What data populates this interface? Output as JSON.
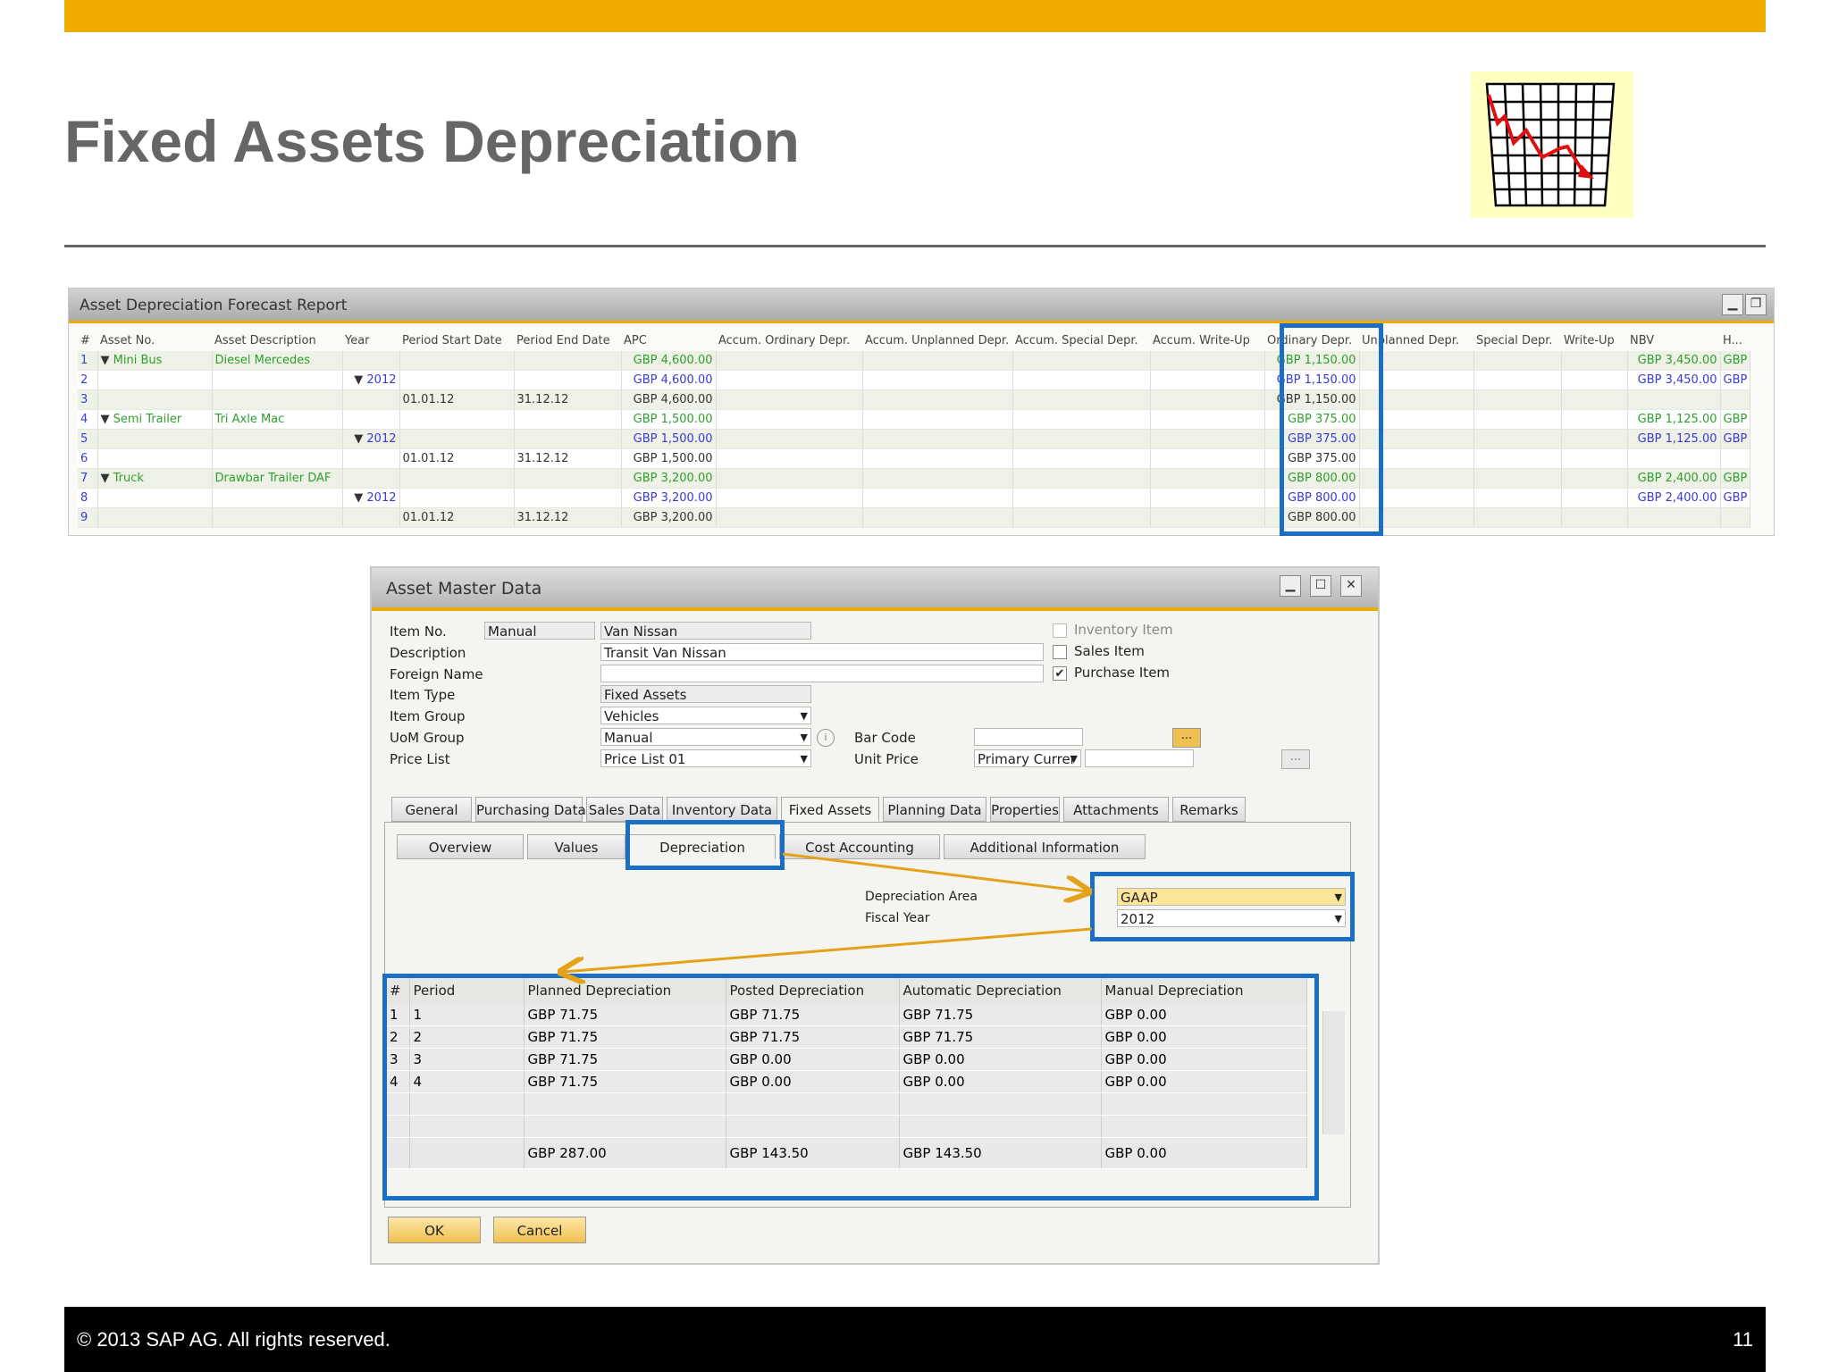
{
  "slide": {
    "title": "Fixed Assets Depreciation",
    "footer_copyright": "©  2013 SAP AG. All rights reserved.",
    "page_number": "11"
  },
  "report": {
    "title": "Asset Depreciation Forecast Report",
    "columns": [
      "#",
      "Asset No.",
      "Asset Description",
      "Year",
      "Period Start Date",
      "Period End Date",
      "APC",
      "Accum. Ordinary Depr.",
      "Accum. Unplanned Depr.",
      "Accum. Special Depr.",
      "Accum. Write-Up",
      "Ordinary Depr.",
      "Unplanned Depr.",
      "Special Depr.",
      "Write-Up",
      "NBV",
      "H..."
    ],
    "rows": [
      {
        "n": "1",
        "asset": "Mini Bus",
        "desc": "Diesel Mercedes",
        "year": "",
        "start": "",
        "end": "",
        "apc": "GBP 4,600.00",
        "ord": "GBP 1,150.00",
        "nbv": "GBP 3,450.00",
        "h": "GBP",
        "color": "grn"
      },
      {
        "n": "2",
        "asset": "",
        "desc": "",
        "year": "2012",
        "start": "",
        "end": "",
        "apc": "GBP 4,600.00",
        "ord": "GBP 1,150.00",
        "nbv": "GBP 3,450.00",
        "h": "GBP",
        "color": "blu"
      },
      {
        "n": "3",
        "asset": "",
        "desc": "",
        "year": "",
        "start": "01.01.12",
        "end": "31.12.12",
        "apc": "GBP 4,600.00",
        "ord": "GBP 1,150.00",
        "nbv": "",
        "h": "",
        "color": "blk"
      },
      {
        "n": "4",
        "asset": "Semi Trailer",
        "desc": "Tri Axle Mac",
        "year": "",
        "start": "",
        "end": "",
        "apc": "GBP 1,500.00",
        "ord": "GBP 375.00",
        "nbv": "GBP 1,125.00",
        "h": "GBP",
        "color": "grn"
      },
      {
        "n": "5",
        "asset": "",
        "desc": "",
        "year": "2012",
        "start": "",
        "end": "",
        "apc": "GBP 1,500.00",
        "ord": "GBP 375.00",
        "nbv": "GBP 1,125.00",
        "h": "GBP",
        "color": "blu"
      },
      {
        "n": "6",
        "asset": "",
        "desc": "",
        "year": "",
        "start": "01.01.12",
        "end": "31.12.12",
        "apc": "GBP 1,500.00",
        "ord": "GBP 375.00",
        "nbv": "",
        "h": "",
        "color": "blk"
      },
      {
        "n": "7",
        "asset": "Truck",
        "desc": "Drawbar Trailer DAF",
        "year": "",
        "start": "",
        "end": "",
        "apc": "GBP 3,200.00",
        "ord": "GBP 800.00",
        "nbv": "GBP 2,400.00",
        "h": "GBP",
        "color": "grn"
      },
      {
        "n": "8",
        "asset": "",
        "desc": "",
        "year": "2012",
        "start": "",
        "end": "",
        "apc": "GBP 3,200.00",
        "ord": "GBP 800.00",
        "nbv": "GBP 2,400.00",
        "h": "GBP",
        "color": "blu"
      },
      {
        "n": "9",
        "asset": "",
        "desc": "",
        "year": "",
        "start": "01.01.12",
        "end": "31.12.12",
        "apc": "GBP 3,200.00",
        "ord": "GBP 800.00",
        "nbv": "",
        "h": "",
        "color": "blk"
      }
    ]
  },
  "dialog": {
    "title": "Asset Master Data",
    "labels": {
      "item_no": "Item No.",
      "description": "Description",
      "foreign_name": "Foreign Name",
      "item_type": "Item Type",
      "item_group": "Item Group",
      "uom_group": "UoM Group",
      "price_list": "Price List",
      "bar_code": "Bar Code",
      "unit_price": "Unit Price",
      "inventory_item": "Inventory Item",
      "sales_item": "Sales Item",
      "purchase_item": "Purchase Item"
    },
    "values": {
      "item_no_series": "Manual",
      "item_no": "Van Nissan",
      "description": "Transit Van Nissan",
      "foreign_name": "",
      "item_type": "Fixed Assets",
      "item_group": "Vehicles",
      "uom_group": "Manual",
      "price_list": "Price List 01",
      "bar_code": "",
      "unit_price_currency": "Primary Currer",
      "unit_price": "",
      "inventory_item_checked": false,
      "sales_item_checked": false,
      "purchase_item_checked": true
    },
    "browse_label": "...",
    "tabs": [
      "General",
      "Purchasing Data",
      "Sales Data",
      "Inventory Data",
      "Fixed Assets",
      "Planning Data",
      "Properties",
      "Attachments",
      "Remarks"
    ],
    "active_tab": "Fixed Assets",
    "subtabs": [
      "Overview",
      "Values",
      "Depreciation",
      "Cost Accounting",
      "Additional Information"
    ],
    "active_subtab": "Depreciation",
    "depreciation_area_label": "Depreciation Area",
    "depreciation_area": "GAAP",
    "fiscal_year_label": "Fiscal Year",
    "fiscal_year": "2012",
    "grid": {
      "columns": [
        "#",
        "Period",
        "Planned Depreciation",
        "Posted Depreciation",
        "Automatic Depreciation",
        "Manual Depreciation"
      ],
      "rows": [
        [
          "1",
          "1",
          "GBP 71.75",
          "GBP 71.75",
          "GBP 71.75",
          "GBP 0.00"
        ],
        [
          "2",
          "2",
          "GBP 71.75",
          "GBP 71.75",
          "GBP 71.75",
          "GBP 0.00"
        ],
        [
          "3",
          "3",
          "GBP 71.75",
          "GBP 0.00",
          "GBP 0.00",
          "GBP 0.00"
        ],
        [
          "4",
          "4",
          "GBP 71.75",
          "GBP 0.00",
          "GBP 0.00",
          "GBP 0.00"
        ]
      ],
      "totals": [
        "",
        "",
        "GBP 287.00",
        "GBP 143.50",
        "GBP 143.50",
        "GBP 0.00"
      ]
    },
    "ok_label": "OK",
    "cancel_label": "Cancel"
  },
  "colors": {
    "accent": "#f0ab00",
    "highlight": "#1a6fc4",
    "arrow": "#e3a21a"
  }
}
